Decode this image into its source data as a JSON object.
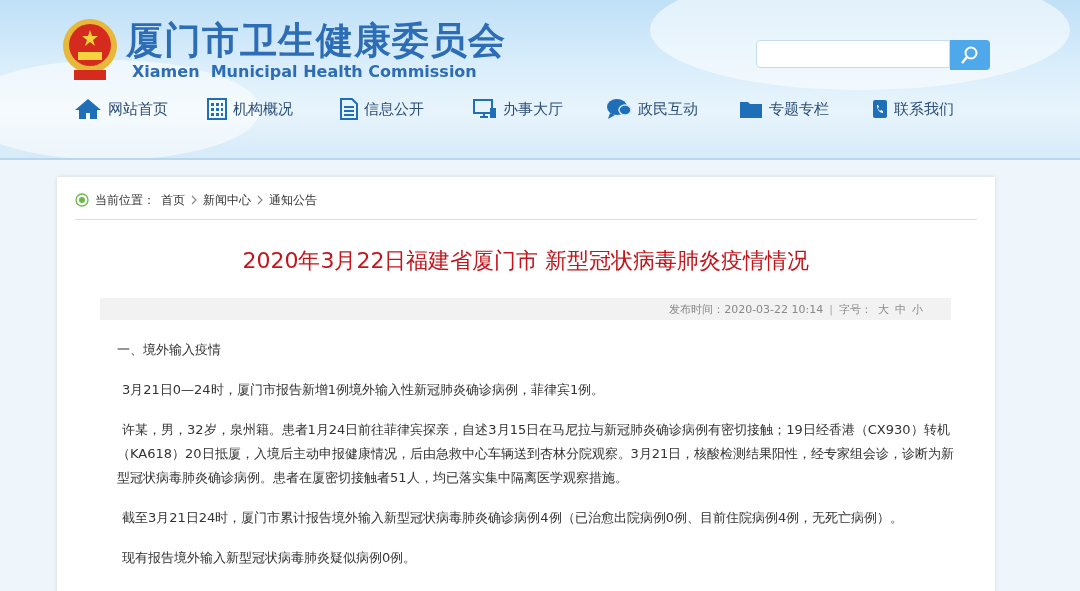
{
  "header": {
    "title": "厦门市卫生健康委员会",
    "subtitle": "Xiamen  Municipal Health Commission"
  },
  "nav": [
    {
      "label": "网站首页"
    },
    {
      "label": "机构概况"
    },
    {
      "label": "信息公开"
    },
    {
      "label": "办事大厅"
    },
    {
      "label": "政民互动"
    },
    {
      "label": "专题专栏"
    },
    {
      "label": "联系我们"
    }
  ],
  "breadcrumb": {
    "label": "当前位置：",
    "items": [
      "首页",
      "新闻中心",
      "通知公告"
    ]
  },
  "article": {
    "title": "2020年3月22日福建省厦门市 新型冠状病毒肺炎疫情情况",
    "published": "发布时间：2020-03-22 10:14",
    "separator": "|",
    "font_size_label": "字号：",
    "font_sizes": [
      "大",
      "中",
      "小"
    ],
    "paragraphs": [
      {
        "kind": "heading",
        "text": "一、境外输入疫情"
      },
      {
        "kind": "body",
        "text": "3月21日0—24时，厦门市报告新增1例境外输入性新冠肺炎确诊病例，菲律宾1例。"
      },
      {
        "kind": "body",
        "text": "许某，男，32岁，泉州籍。患者1月24日前往菲律宾探亲，自述3月15日在马尼拉与新冠肺炎确诊病例有密切接触；19日经香港（CX930）转机（KA618）20日抵厦，入境后主动申报健康情况，后由急救中心车辆送到杏林分院观察。3月21日，核酸检测结果阳性，经专家组会诊，诊断为新型冠状病毒肺炎确诊病例。患者在厦密切接触者51人，均已落实集中隔离医学观察措施。"
      },
      {
        "kind": "body",
        "text": "截至3月21日24时，厦门市累计报告境外输入新型冠状病毒肺炎确诊病例4例（已治愈出院病例0例、目前住院病例4例，无死亡病例）。"
      },
      {
        "kind": "body",
        "text": "现有报告境外输入新型冠状病毒肺炎疑似病例0例。"
      }
    ]
  }
}
